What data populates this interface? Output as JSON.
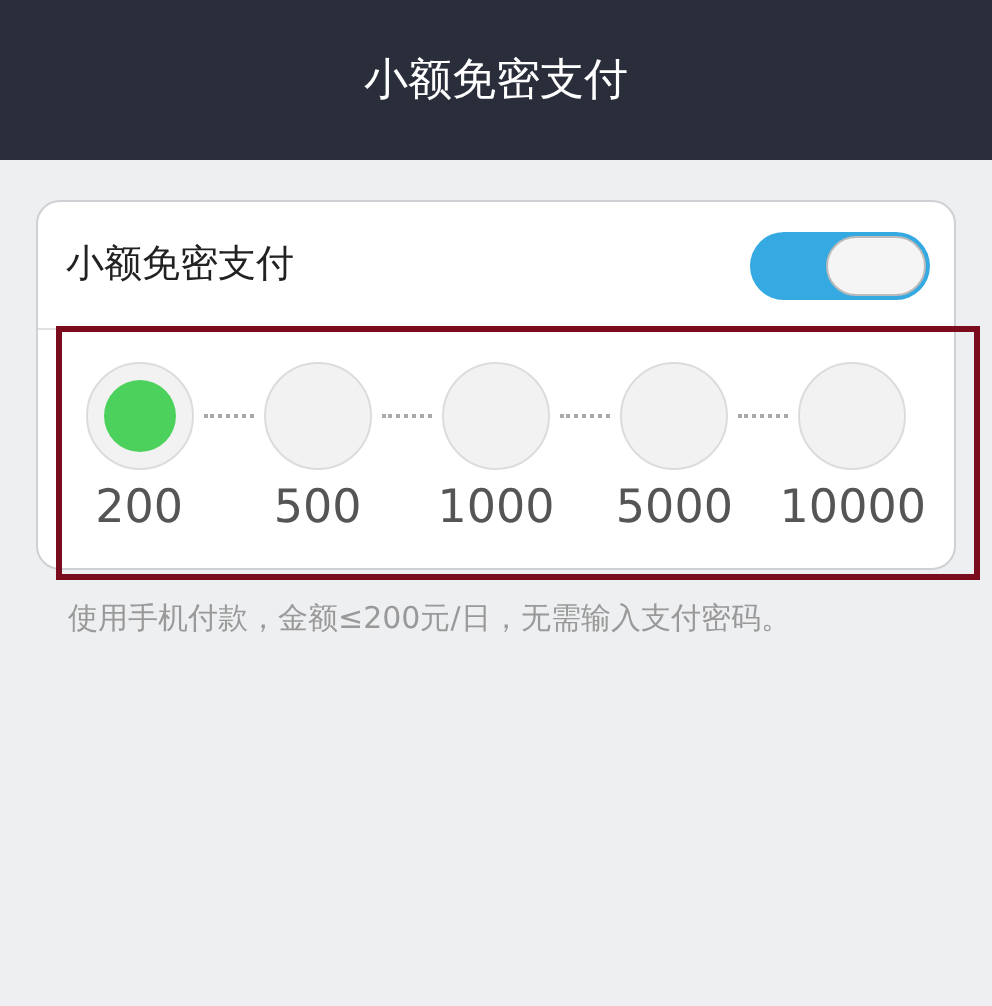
{
  "header": {
    "title": "小额免密支付"
  },
  "card": {
    "label": "小额免密支付",
    "on": true,
    "limits": {
      "highlighted": true,
      "options": [
        {
          "label": "200",
          "selected": true
        },
        {
          "label": "500",
          "selected": false
        },
        {
          "label": "1000",
          "selected": false
        },
        {
          "label": "5000",
          "selected": false
        },
        {
          "label": "10000",
          "selected": false
        }
      ]
    }
  },
  "note": "使用手机付款，金额≤200元/日，无需输入支付密码。"
}
